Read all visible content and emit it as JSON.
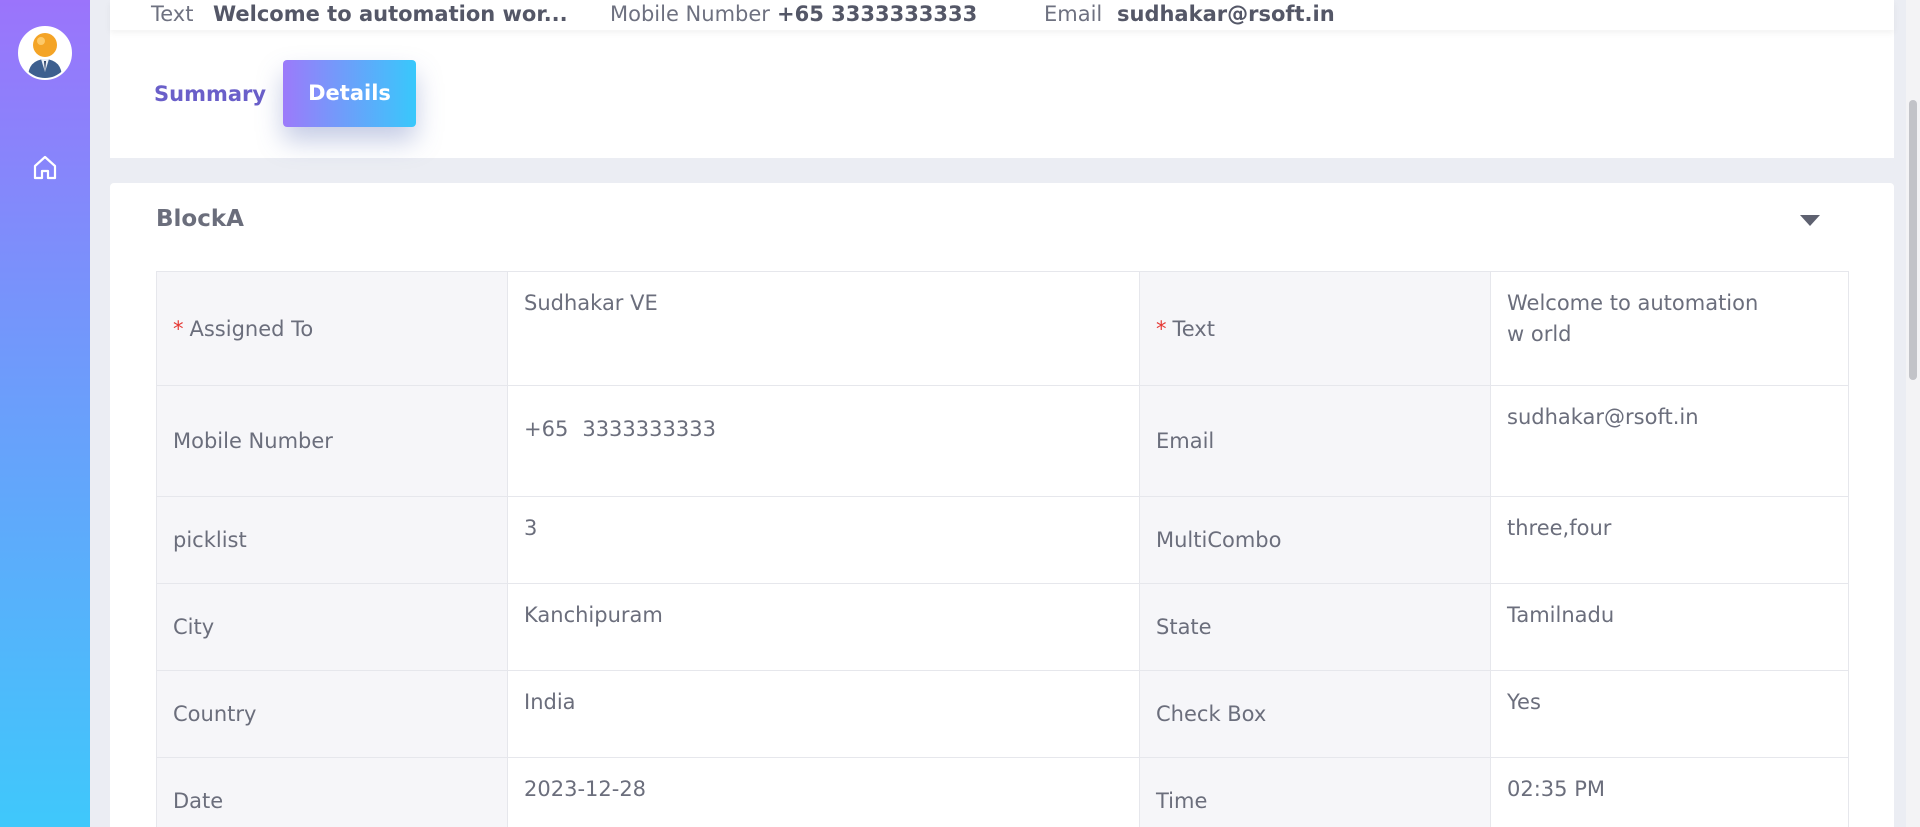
{
  "summary": {
    "text_label": "Text",
    "text_value": "Welcome to automation wor...",
    "mobile_label": "Mobile Number",
    "mobile_value": "+65 3333333333",
    "email_label": "Email",
    "email_value": "sudhakar@rsoft.in"
  },
  "tabs": {
    "summary": "Summary",
    "details": "Details"
  },
  "block": {
    "title": "BlockA",
    "required_mark": "*",
    "rows": [
      {
        "left_label": "Assigned To",
        "left_value": "Sudhakar VE",
        "right_label": "Text",
        "right_value": "Welcome to automation w orld"
      },
      {
        "left_label": "Mobile Number",
        "left_code": "+65",
        "left_value": "3333333333",
        "right_label": "Email",
        "right_value": "sudhakar@rsoft.in"
      },
      {
        "left_label": "picklist",
        "left_value": "3",
        "right_label": "MultiCombo",
        "right_value": "three,four"
      },
      {
        "left_label": "City",
        "left_value": "Kanchipuram",
        "right_label": "State",
        "right_value": "Tamilnadu"
      },
      {
        "left_label": "Country",
        "left_value": "India",
        "right_label": "Check Box",
        "right_value": "Yes"
      },
      {
        "left_label": "Date",
        "left_value": "2023-12-28",
        "right_label": "Time",
        "right_value": "02:35 PM"
      }
    ]
  },
  "icons": {
    "avatar": "user-avatar",
    "home": "home-icon",
    "collapse": "caret-down-icon"
  },
  "colors": {
    "sidebar_top": "#9b74fb",
    "sidebar_bottom": "#3fc8fb",
    "tab_active_start": "#9c7afa",
    "tab_active_end": "#38c8fb",
    "link": "#6a5fc9",
    "required": "#e53935"
  }
}
